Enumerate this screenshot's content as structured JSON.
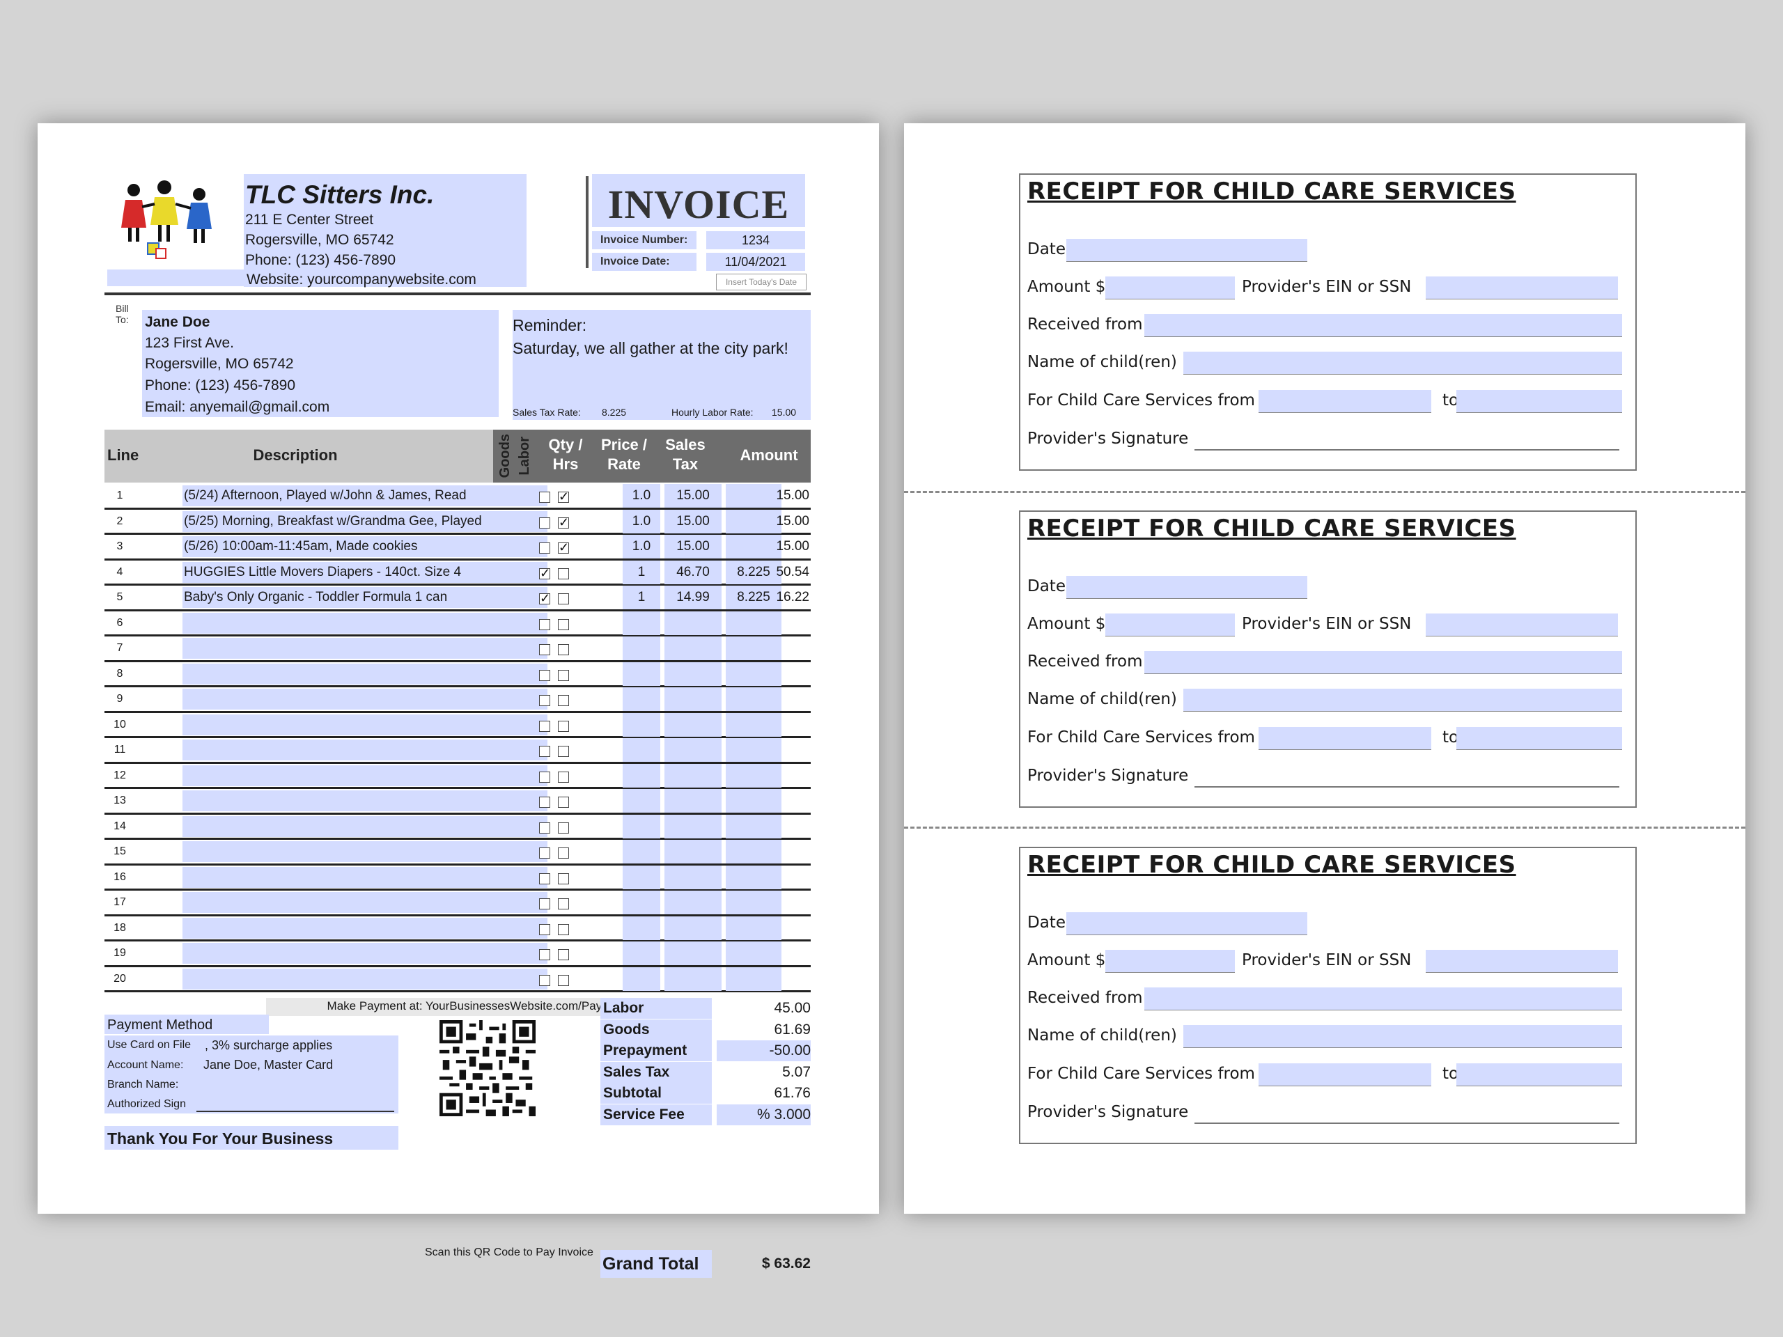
{
  "company": {
    "name": "TLC Sitters Inc.",
    "street": "211  E  Center  Street",
    "city": "Rogersville, MO 65742",
    "phone": "Phone: (123) 456-7890",
    "website": "Website: yourcompanywebsite.com"
  },
  "invoice": {
    "title": "INVOICE",
    "number_label": "Invoice Number:",
    "number": "1234",
    "date_label": "Invoice Date:",
    "date": "11/04/2021",
    "insert_date_button": "Insert Today's Date"
  },
  "bill_to": {
    "label_1": "Bill",
    "label_2": "To:",
    "name": "Jane Doe",
    "street": "123 First Ave.",
    "city": "Rogersville, MO 65742",
    "phone": "Phone: (123) 456-7890",
    "email": "Email: anyemail@gmail.com"
  },
  "reminder": {
    "label": "Reminder:",
    "text": "Saturday, we all gather at the city park!"
  },
  "rates": {
    "sales_tax_label": "Sales Tax Rate:",
    "sales_tax_value": "8.225",
    "hourly_label": "Hourly Labor Rate:",
    "hourly_value": "15.00"
  },
  "table": {
    "headers": {
      "line": "Line",
      "description": "Description",
      "goods": "Goods",
      "labor": "Labor",
      "qty_1": "Qty /",
      "qty_2": "Hrs",
      "price_1": "Price /",
      "price_2": "Rate",
      "tax_1": "Sales",
      "tax_2": "Tax",
      "amount": "Amount"
    },
    "rows": [
      {
        "line": "1",
        "desc": "(5/24) Afternoon, Played w/John & James, Read",
        "goods": false,
        "labor": true,
        "qty": "1.0",
        "price": "15.00",
        "tax": "",
        "amount": "15.00"
      },
      {
        "line": "2",
        "desc": "(5/25) Morning, Breakfast w/Grandma Gee, Played",
        "goods": false,
        "labor": true,
        "qty": "1.0",
        "price": "15.00",
        "tax": "",
        "amount": "15.00"
      },
      {
        "line": "3",
        "desc": "(5/26) 10:00am-11:45am, Made cookies",
        "goods": false,
        "labor": true,
        "qty": "1.0",
        "price": "15.00",
        "tax": "",
        "amount": "15.00"
      },
      {
        "line": "4",
        "desc": "HUGGIES Little Movers Diapers - 140ct. Size 4",
        "goods": true,
        "labor": false,
        "qty": "1",
        "price": "46.70",
        "tax": "8.225",
        "amount": "50.54"
      },
      {
        "line": "5",
        "desc": "Baby's Only Organic - Toddler Formula 1 can",
        "goods": true,
        "labor": false,
        "qty": "1",
        "price": "14.99",
        "tax": "8.225",
        "amount": "16.22"
      },
      {
        "line": "6",
        "desc": "",
        "goods": false,
        "labor": false,
        "qty": "",
        "price": "",
        "tax": "",
        "amount": ""
      },
      {
        "line": "7",
        "desc": "",
        "goods": false,
        "labor": false,
        "qty": "",
        "price": "",
        "tax": "",
        "amount": ""
      },
      {
        "line": "8",
        "desc": "",
        "goods": false,
        "labor": false,
        "qty": "",
        "price": "",
        "tax": "",
        "amount": ""
      },
      {
        "line": "9",
        "desc": "",
        "goods": false,
        "labor": false,
        "qty": "",
        "price": "",
        "tax": "",
        "amount": ""
      },
      {
        "line": "10",
        "desc": "",
        "goods": false,
        "labor": false,
        "qty": "",
        "price": "",
        "tax": "",
        "amount": ""
      },
      {
        "line": "11",
        "desc": "",
        "goods": false,
        "labor": false,
        "qty": "",
        "price": "",
        "tax": "",
        "amount": ""
      },
      {
        "line": "12",
        "desc": "",
        "goods": false,
        "labor": false,
        "qty": "",
        "price": "",
        "tax": "",
        "amount": ""
      },
      {
        "line": "13",
        "desc": "",
        "goods": false,
        "labor": false,
        "qty": "",
        "price": "",
        "tax": "",
        "amount": ""
      },
      {
        "line": "14",
        "desc": "",
        "goods": false,
        "labor": false,
        "qty": "",
        "price": "",
        "tax": "",
        "amount": ""
      },
      {
        "line": "15",
        "desc": "",
        "goods": false,
        "labor": false,
        "qty": "",
        "price": "",
        "tax": "",
        "amount": ""
      },
      {
        "line": "16",
        "desc": "",
        "goods": false,
        "labor": false,
        "qty": "",
        "price": "",
        "tax": "",
        "amount": ""
      },
      {
        "line": "17",
        "desc": "",
        "goods": false,
        "labor": false,
        "qty": "",
        "price": "",
        "tax": "",
        "amount": ""
      },
      {
        "line": "18",
        "desc": "",
        "goods": false,
        "labor": false,
        "qty": "",
        "price": "",
        "tax": "",
        "amount": ""
      },
      {
        "line": "19",
        "desc": "",
        "goods": false,
        "labor": false,
        "qty": "",
        "price": "",
        "tax": "",
        "amount": ""
      },
      {
        "line": "20",
        "desc": "",
        "goods": false,
        "labor": false,
        "qty": "",
        "price": "",
        "tax": "",
        "amount": ""
      }
    ]
  },
  "footer": {
    "make_payment": "Make Payment at: YourBusinessesWebsite.com/Payment",
    "payment_method": "Payment Method",
    "use_card_label": "Use Card on File",
    "use_card_value": ", 3% surcharge applies",
    "account_label": "Account Name:",
    "account_value": "Jane Doe, Master Card",
    "branch_label": "Branch Name:",
    "sign_label": "Authorized Sign",
    "thank_you": "Thank You For Your Business",
    "qr_caption": "Scan this QR Code to Pay Invoice"
  },
  "totals": [
    {
      "label": "Labor",
      "value": "45.00"
    },
    {
      "label": "Goods",
      "value": "61.69"
    },
    {
      "label": "Prepayment",
      "value": "-50.00"
    },
    {
      "label": "Sales Tax",
      "value": "5.07"
    },
    {
      "label": "Subtotal",
      "value": "61.76"
    },
    {
      "label": "Service Fee",
      "value": "% 3.000"
    }
  ],
  "grand_total": {
    "label": "Grand Total",
    "value": "$ 63.62"
  },
  "receipt": {
    "title": "RECEIPT FOR CHILD CARE SERVICES",
    "date": "Date",
    "amount": "Amount $",
    "ein": "Provider's EIN or SSN",
    "received_from": "Received from",
    "children": "Name of child(ren)",
    "services_from": "For Child Care Services from",
    "to": "to",
    "signature": "Provider's Signature"
  },
  "colors": {
    "field_fill": "#d4dcff",
    "header_dark": "#6d6d6d",
    "header_light": "#c8c8c8"
  }
}
